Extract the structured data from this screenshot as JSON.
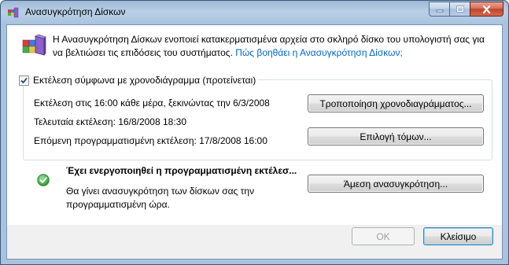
{
  "window": {
    "title": "Ανασυγκρότηση Δίσκων"
  },
  "intro": {
    "text": "Η Ανασυγκρότηση Δίσκων ενοποιεί κατακερματισμένα αρχεία στο σκληρό δίσκο του υπολογιστή σας για να βελτιώσει τις επιδόσεις του συστήματος.",
    "help_link": "Πώς βοηθάει η Ανασυγκρότηση Δίσκων;"
  },
  "schedule": {
    "checkbox_label": "Εκτέλεση σύμφωνα με χρονοδιάγραμμα (προτείνεται)",
    "checked": true,
    "run_at": "Εκτέλεση στις 16:00 κάθε μέρα, ξεκινώντας την 6/3/2008",
    "last_run": "Τελευταία εκτέλεση: 16/8/2008 18:30",
    "next_run": "Επόμενη προγραμματισμένη εκτέλεση: 17/8/2008 16:00",
    "modify_button": "Τροποποίηση χρονοδιαγράμματος...",
    "select_volumes_button": "Επιλογή τόμων..."
  },
  "status": {
    "title": "Έχει ενεργοποιηθεί η προγραμματισμένη εκτέλεσ...",
    "description": "Θα γίνει ανασυγκρότηση των δίσκων σας την προγραμματισμένη ώρα.",
    "defrag_now_button": "Άμεση ανασυγκρότηση..."
  },
  "footer": {
    "ok_button": "OK",
    "close_button": "Κλείσιμο"
  },
  "colors": {
    "link": "#0066cc",
    "title_bar": "#a9c3df",
    "close_button": "#c0432a",
    "status_ok": "#3aa63a"
  },
  "icons": {
    "app": "defrag-icon",
    "status": "checkmark-circle-icon"
  }
}
